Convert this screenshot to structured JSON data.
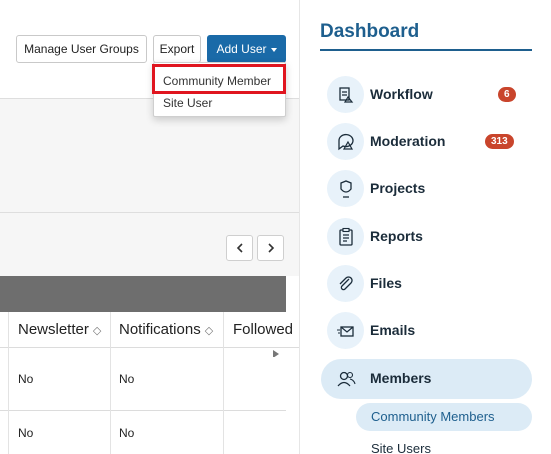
{
  "toolbar": {
    "manage_groups_label": "Manage User Groups",
    "export_label": "Export",
    "add_user_label": "Add User"
  },
  "dropdown": {
    "items": [
      "Community Member",
      "Site User"
    ],
    "highlighted_item": "Community Member"
  },
  "table": {
    "columns": [
      "Newsletter",
      "Notifications",
      "Followed"
    ],
    "rows": [
      [
        "No",
        "No"
      ],
      [
        "No",
        "No"
      ]
    ]
  },
  "sidebar": {
    "title": "Dashboard",
    "items": [
      {
        "label": "Workflow",
        "icon": "workflow-icon",
        "badge": "6"
      },
      {
        "label": "Moderation",
        "icon": "moderation-icon",
        "badge": "313"
      },
      {
        "label": "Projects",
        "icon": "projects-icon",
        "badge": ""
      },
      {
        "label": "Reports",
        "icon": "reports-icon",
        "badge": ""
      },
      {
        "label": "Files",
        "icon": "files-icon",
        "badge": ""
      },
      {
        "label": "Emails",
        "icon": "emails-icon",
        "badge": ""
      },
      {
        "label": "Members",
        "icon": "members-icon",
        "badge": "",
        "active": true
      }
    ],
    "subitems": [
      "Community Members",
      "Site Users"
    ]
  },
  "colors": {
    "primary_button": "#1a6aa8",
    "accent_blue": "#1e5f8e",
    "badge_red": "#c9452c",
    "highlight_red": "#e0151f",
    "active_bg": "#dcebf6"
  }
}
